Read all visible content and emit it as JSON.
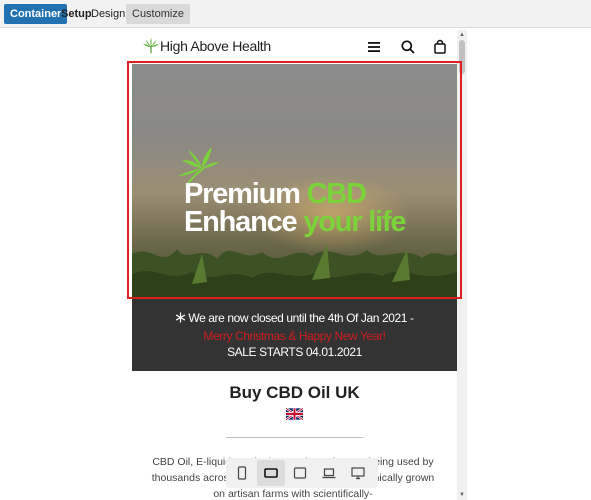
{
  "toolbar": {
    "container_label": "Container",
    "setup_label": "Setup",
    "design_label": "Design",
    "customize_label": "Customize"
  },
  "site": {
    "logo_text": "High Above Health",
    "header_icons": [
      "menu-icon",
      "search-icon",
      "bag-icon"
    ]
  },
  "hero": {
    "line1_a": "Premium ",
    "line1_b": "CBD",
    "line2_a": "Enhance",
    "line2_b": " your life"
  },
  "notice": {
    "icon": "snowflake-icon",
    "line1": "We are now closed until the 4th Of Jan 2021 -",
    "line2": "Merry Christmas & Happy New Year!",
    "line3": "SALE STARTS 04.01.2021"
  },
  "content": {
    "title": "Buy CBD Oil UK",
    "flag_icon": "uk-flag-icon",
    "paragraph": "CBD Oil, E-liquids and other products that are being used by thousands across the UK and full care and organically grown on artisan farms with scientifically-"
  },
  "device_bar": {
    "devices": [
      "mobile-icon",
      "tablet-landscape-icon",
      "tablet-icon",
      "laptop-icon",
      "desktop-icon"
    ],
    "active": "tablet-landscape-icon"
  },
  "colors": {
    "accent_blue": "#2271b1",
    "brand_green": "#7bd33a",
    "notice_red": "#cc1f1f",
    "notice_bg": "#333333",
    "selection_red": "#e02020"
  }
}
